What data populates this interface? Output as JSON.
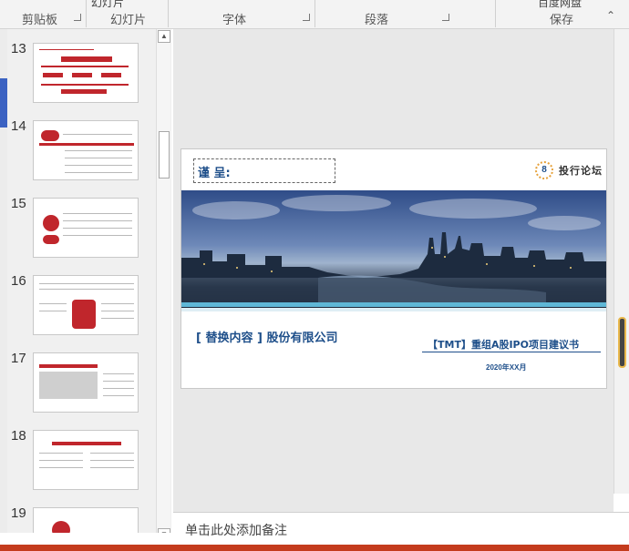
{
  "ribbon": {
    "groups": [
      {
        "label": "剪贴板"
      },
      {
        "label": "幻灯片"
      },
      {
        "label": "字体"
      },
      {
        "label": "段落"
      },
      {
        "label": "保存"
      }
    ],
    "cut_labels": {
      "slides_cmd": "幻灯片",
      "save_cmd": "百度网盘"
    }
  },
  "thumbnails": [
    {
      "number": "13"
    },
    {
      "number": "14"
    },
    {
      "number": "15"
    },
    {
      "number": "16"
    },
    {
      "number": "17"
    },
    {
      "number": "18"
    },
    {
      "number": "19"
    }
  ],
  "slide": {
    "attn": "谨 呈:",
    "brand_name": "投行论坛",
    "brand_mark": "8",
    "company": "[ 替换内容 ] 股份有限公司",
    "project": "【TMT】重组A股IPO项目建议书",
    "date": "2020年XX月"
  },
  "notes": {
    "placeholder": "单击此处添加备注"
  },
  "colors": {
    "accent": "#1e4f8a",
    "status_bar": "#c43b1d",
    "thumb_red": "#c0262c"
  }
}
